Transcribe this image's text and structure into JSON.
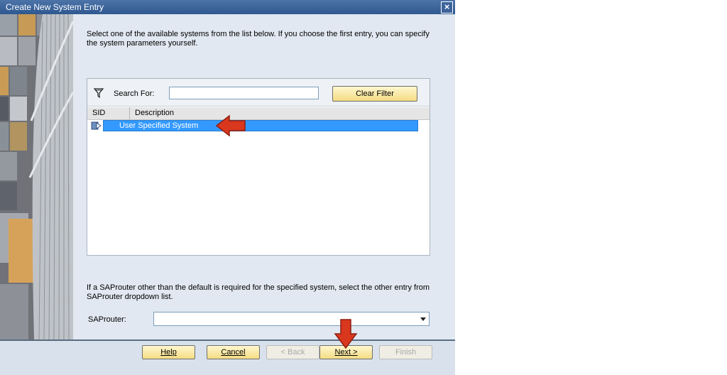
{
  "window": {
    "title": "Create New System Entry"
  },
  "intro_text": "Select one of the available systems from the list below. If you choose the first entry, you can specify the system parameters yourself.",
  "search": {
    "label": "Search For:",
    "value": "",
    "clear_filter_label": "Clear Filter"
  },
  "table": {
    "columns": [
      "SID",
      "Description"
    ],
    "rows": [
      {
        "sid": "",
        "description": "User Specified System",
        "selected": true
      }
    ]
  },
  "saprouter": {
    "hint": "If a SAProuter other than the default is required for the specified system, select the other entry from SAProuter dropdown list.",
    "label": "SAProuter:",
    "value": ""
  },
  "buttons": {
    "help": "Help",
    "cancel": "Cancel",
    "back": "< Back",
    "next": "Next >",
    "finish": "Finish"
  },
  "colors": {
    "selection": "#3399ff",
    "button": "#f4dc83",
    "annotation_arrow": "#d9371e"
  }
}
